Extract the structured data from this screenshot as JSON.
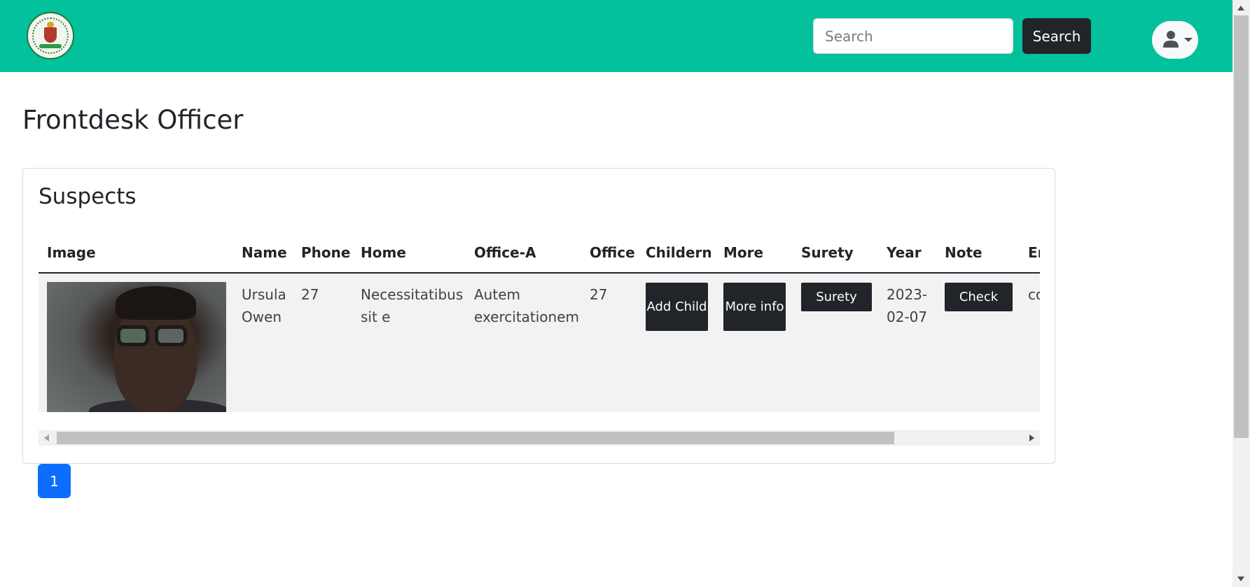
{
  "navbar": {
    "logo_icon": "nigeria-coat-of-arms-logo",
    "search": {
      "placeholder": "Search",
      "value": ""
    },
    "search_button_label": "Search",
    "user_menu_icon": "user-icon",
    "accent_color": "#03c19c"
  },
  "page": {
    "title": "Frontdesk Officer"
  },
  "card": {
    "title": "Suspects",
    "table": {
      "columns": [
        "Image",
        "Name",
        "Phone",
        "Home",
        "Office-A",
        "Office",
        "Childern",
        "More",
        "Surety",
        "Year",
        "Note",
        "Em"
      ],
      "rows": [
        {
          "image": "suspect-photo",
          "name": "Ursula Owen",
          "phone": "27",
          "home": "Necessitatibus sit e",
          "office_a": "Autem exercitationem",
          "office": "27",
          "add_child_label": "Add Child",
          "more_info_label": "More info",
          "surety_label": "Surety",
          "year": "2023-02-07",
          "check_label": "Check",
          "email": "co"
        }
      ]
    }
  },
  "pagination": {
    "current": "1",
    "color": "#0d6efd"
  }
}
